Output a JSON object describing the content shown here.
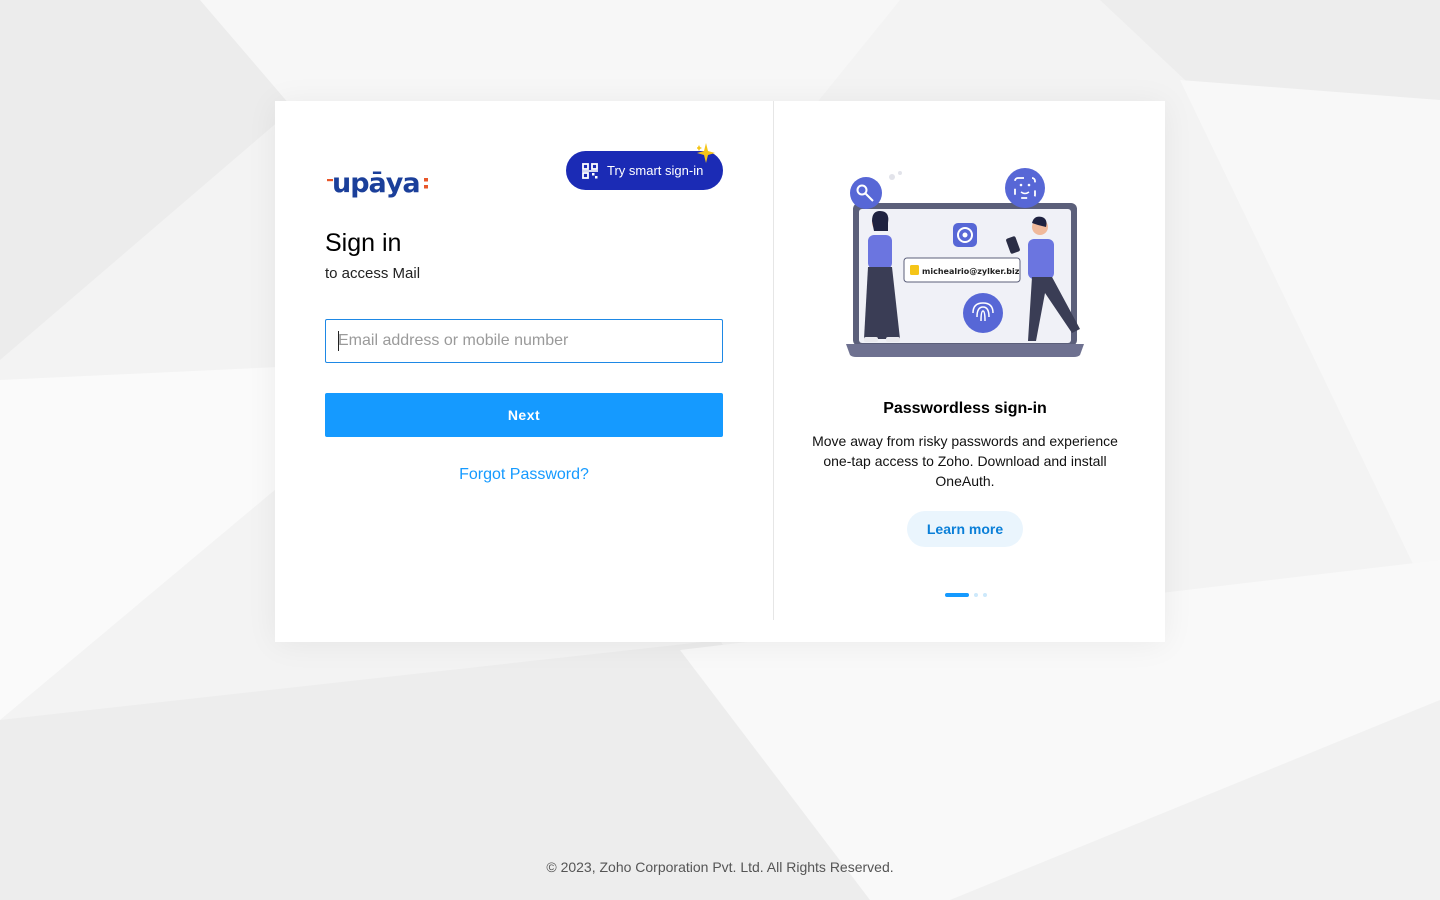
{
  "brand": {
    "logo_text": "upāya",
    "accent_blue": "#1b3f9a",
    "accent_orange": "#e8572a"
  },
  "smart_signin": {
    "label": "Try smart sign-in",
    "icon": "qr-code-icon",
    "bg_color": "#1b2bb5"
  },
  "signin": {
    "title": "Sign in",
    "subtitle": "to access Mail",
    "email_placeholder": "Email address or mobile number",
    "email_value": "",
    "next_label": "Next",
    "forgot_label": "Forgot Password?",
    "primary_color": "#159aff"
  },
  "promo": {
    "illustration_email": "michealrio@zylker.biz",
    "title": "Passwordless sign-in",
    "text": "Move away from risky passwords and experience one-tap access to Zoho. Download and install OneAuth.",
    "learn_more_label": "Learn more",
    "slide_active_index": 0,
    "slide_count": 3
  },
  "footer": {
    "copyright": "© 2023, Zoho Corporation Pvt. Ltd. All Rights Reserved."
  }
}
